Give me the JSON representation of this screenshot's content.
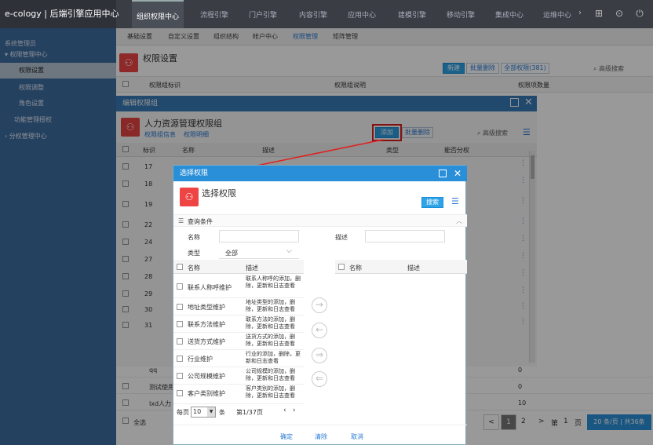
{
  "app": {
    "brand": "e-cology | 后端引擎应用中心"
  },
  "top_tabs": [
    "组织权限中心",
    "流程引擎",
    "门户引擎",
    "内容引擎",
    "应用中心",
    "建模引擎",
    "移动引擎",
    "集成中心",
    "运维中心"
  ],
  "sidebar": {
    "section": "系统管理员",
    "items": [
      {
        "label": "▾ 权限管理中心"
      },
      {
        "label": "权限设置"
      },
      {
        "label": "权限调整"
      },
      {
        "label": "角色设置"
      },
      {
        "label": "功能管理授权"
      },
      {
        "label": "› 分权管理中心"
      }
    ]
  },
  "subnav": [
    "基础设置",
    "自定义设置",
    "组织结构",
    "帐户中心",
    "权限管理",
    "矩阵管理"
  ],
  "page": {
    "title": "权限设置",
    "btn_new": "新建",
    "btn_batch_delete": "批量删除",
    "btn_all": "全部权限(381)",
    "advanced_search": "高级搜索",
    "col_id": "权限组标识",
    "col_desc": "权限组说明",
    "col_count": "权限项数量",
    "bg_rows": [
      {
        "name": "qq",
        "count": "0"
      },
      {
        "name": "测试使用",
        "count": "0"
      },
      {
        "name": "lxd人力",
        "count": "10"
      }
    ],
    "select_all": "全选",
    "pager": {
      "prev": "<",
      "current": "1",
      "next_page": "2",
      "next": ">",
      "goto": "第",
      "page_num": "1",
      "page_unit": "页",
      "summary": "20 条/页 | 共36条"
    }
  },
  "edit_dialog": {
    "title": "编辑权限组",
    "group_name": "人力资源管理权限组",
    "tab_info": "权限组信息",
    "tab_detail": "权限明细",
    "btn_add": "添加",
    "btn_batch_delete": "批量删除",
    "advanced_search": "高级搜索",
    "cols": [
      "标识",
      "名称",
      "描述",
      "类型",
      "能否分权"
    ],
    "rows": [
      "17",
      "18",
      "19",
      "22",
      "24",
      "27",
      "28",
      "29",
      "30",
      "31"
    ]
  },
  "select_dialog": {
    "title": "选择权限",
    "heading": "选择权限",
    "btn_search": "搜索",
    "query_section": "查询条件",
    "label_name": "名称",
    "label_desc": "描述",
    "label_type": "类型",
    "type_value": "全部",
    "left_cols": [
      "名称",
      "描述"
    ],
    "right_cols": [
      "名称",
      "描述"
    ],
    "items": [
      {
        "name": "联系人称呼维护",
        "desc": "联系人称呼的添加，删除，更新和日志查看"
      },
      {
        "name": "地址类型维护",
        "desc": "地址类型的添加，删除，更新和日志查看"
      },
      {
        "name": "联系方法维护",
        "desc": "联系方法的添加，删除，更新和日志查看"
      },
      {
        "name": "送货方式维护",
        "desc": "送货方式的添加，删除，更新和日志查看"
      },
      {
        "name": "行业维护",
        "desc": "行业的添加，删除，更新和日志查看"
      },
      {
        "name": "公司规模维护",
        "desc": "公司规模的添加，删除，更新和日志查看"
      },
      {
        "name": "客户类别维护",
        "desc": "客户类别的添加，删除，更新和日志查看"
      }
    ],
    "per_page_label": "每页",
    "per_page_value": "10",
    "per_page_unit": "条",
    "page_info": "第1/37页",
    "btn_ok": "确定",
    "btn_clear": "清除",
    "btn_cancel": "取消"
  }
}
